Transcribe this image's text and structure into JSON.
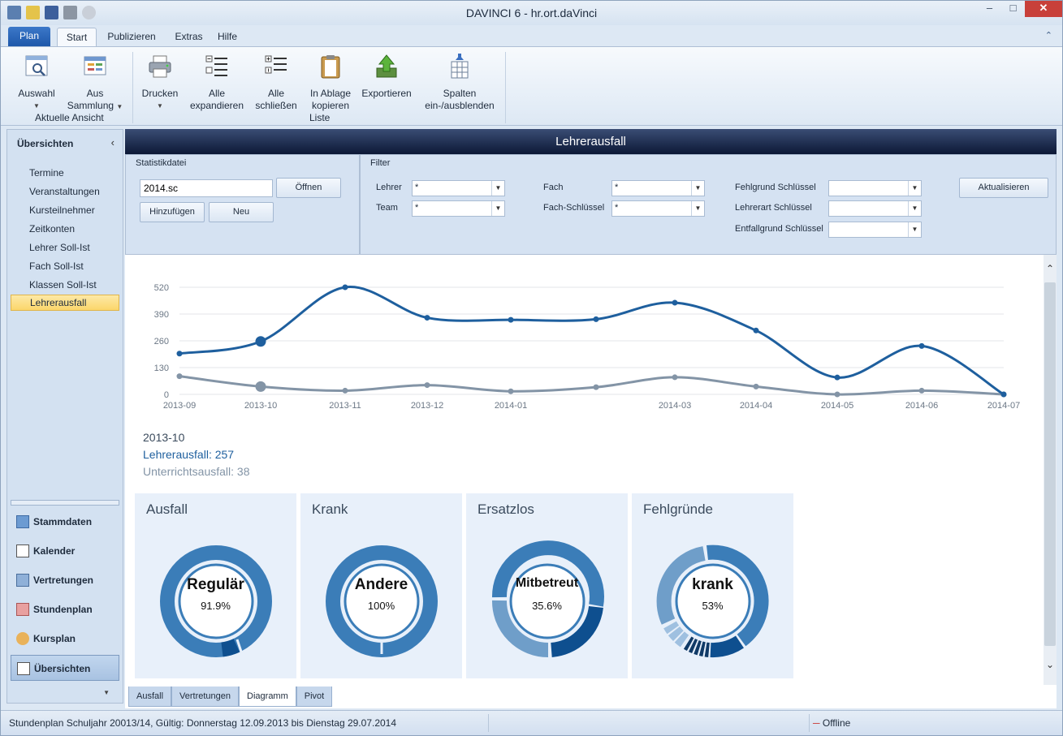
{
  "window": {
    "title": "DAVINCI 6 - hr.ort.daVinci"
  },
  "ribbon_tabs": {
    "app": "Plan",
    "start": "Start",
    "publizieren": "Publizieren",
    "extras": "Extras",
    "hilfe": "Hilfe"
  },
  "ribbon": {
    "auswahl": "Auswahl",
    "aus_sammlung_1": "Aus",
    "aus_sammlung_2": "Sammlung",
    "group_aktuelle": "Aktuelle Ansicht",
    "drucken": "Drucken",
    "alle_exp_1": "Alle",
    "alle_exp_2": "expandieren",
    "alle_schl_1": "Alle",
    "alle_schl_2": "schließen",
    "ablage_1": "In Ablage",
    "ablage_2": "kopieren",
    "exportieren": "Exportieren",
    "spalten_1": "Spalten",
    "spalten_2": "ein-/ausblenden",
    "group_liste": "Liste"
  },
  "sidebar": {
    "heading": "Übersichten",
    "items": [
      "Termine",
      "Veranstaltungen",
      "Kursteilnehmer",
      "Zeitkonten",
      "Lehrer Soll-Ist",
      "Fach Soll-Ist",
      "Klassen Soll-Ist",
      "Lehrerausfall"
    ],
    "nav": [
      "Stammdaten",
      "Kalender",
      "Vertretungen",
      "Stundenplan",
      "Kursplan",
      "Übersichten"
    ]
  },
  "content": {
    "header": "Lehrerausfall",
    "stat_title": "Statistikdatei",
    "file_value": "2014.sc",
    "open_btn": "Öffnen",
    "add_btn": "Hinzufügen",
    "new_btn": "Neu",
    "filter_title": "Filter",
    "lehrer_label": "Lehrer",
    "lehrer_value": "*",
    "team_label": "Team",
    "team_value": "*",
    "fach_label": "Fach",
    "fach_value": "*",
    "fachkey_label": "Fach-Schlüssel",
    "fachkey_value": "*",
    "fehlgrund_label": "Fehlgrund Schlüssel",
    "lehrerart_label": "Lehrerart Schlüssel",
    "entfall_label": "Entfallgrund Schlüssel",
    "refresh_btn": "Aktualisieren"
  },
  "chart_data": {
    "type": "line",
    "x_tick_labels": [
      "2013-09",
      "2013-10",
      "2013-11",
      "2013-12",
      "2014-01",
      "2014-03",
      "2014-04",
      "2014-05",
      "2014-06",
      "2014-07"
    ],
    "y_ticks": [
      0,
      130,
      260,
      390,
      520
    ],
    "ylim": [
      0,
      520
    ],
    "grid": true,
    "x": [
      "2013-09",
      "2013-10",
      "2013-11",
      "2013-12",
      "2014-01",
      "2014-02",
      "2014-03",
      "2014-04",
      "2014-05",
      "2014-06",
      "2014-07"
    ],
    "series": [
      {
        "name": "Lehrerausfall",
        "color": "#1e5f9e",
        "values": [
          198,
          257,
          520,
          372,
          362,
          365,
          445,
          310,
          82,
          235,
          0
        ]
      },
      {
        "name": "Unterrichtsausfall",
        "color": "#8394a6",
        "values": [
          88,
          38,
          18,
          45,
          15,
          35,
          83,
          38,
          0,
          18,
          0
        ]
      }
    ],
    "hover": {
      "x": "2013-10",
      "line1": "Lehrerausfall: 257",
      "line2": "Unterrichtsausfall: 38"
    }
  },
  "kpis": [
    {
      "title": "Ausfall",
      "label": "Regulär",
      "pct": "91.9%",
      "value": 0.919
    },
    {
      "title": "Krank",
      "label": "Andere",
      "pct": "100%",
      "value": 1.0
    },
    {
      "title": "Ersatzlos",
      "label": "Mitbetreut",
      "pct": "35.6%",
      "value": 0.356
    },
    {
      "title": "Fehlgründe",
      "label": "krank",
      "pct": "53%",
      "value": 0.53
    }
  ],
  "bottom_tabs": [
    "Ausfall",
    "Vertretungen",
    "Diagramm",
    "Pivot"
  ],
  "status": {
    "left": "Stundenplan Schuljahr 20013/14, Gültig: Donnerstag 12.09.2013 bis Dienstag 29.07.2014",
    "right": "Offline"
  },
  "colors": {
    "accent": "#1e5f9e",
    "secondary": "#8394a6",
    "donut": "#3b7db8",
    "header": "#0c1836"
  }
}
